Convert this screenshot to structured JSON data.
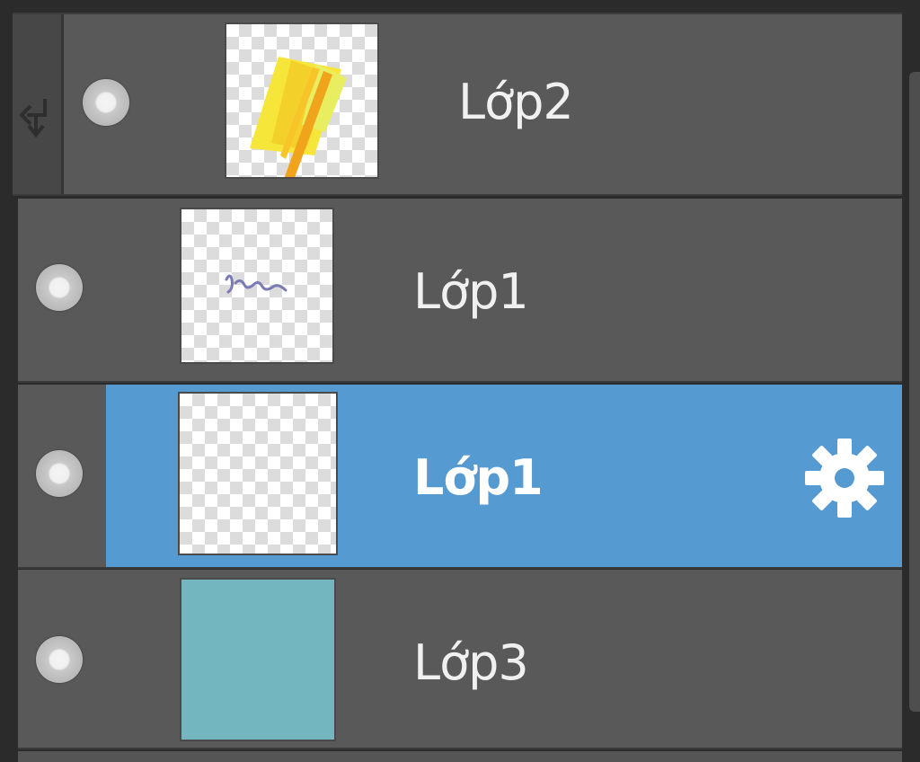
{
  "layers": [
    {
      "name": "Lớp2",
      "clipping": true,
      "selected": false,
      "visible": true,
      "thumbnail": "yellow-orange-stroke"
    },
    {
      "name": "Lớp1",
      "clipping": false,
      "selected": false,
      "visible": true,
      "thumbnail": "small-purple-scribble"
    },
    {
      "name": "Lớp1",
      "clipping": false,
      "selected": true,
      "visible": true,
      "thumbnail": "transparent"
    },
    {
      "name": "Lớp3",
      "clipping": false,
      "selected": false,
      "visible": true,
      "thumbnail": "solid-teal",
      "fill_color": "#74b6c0"
    }
  ],
  "colors": {
    "panel_bg": "#2b2b2b",
    "row_bg": "#595959",
    "selected_bg": "#559ad0",
    "clip_strip_bg": "#474747"
  },
  "icons": {
    "clip_indicator": "clip-arrow-icon",
    "visibility": "eye-dot-icon",
    "settings": "gear-icon"
  }
}
